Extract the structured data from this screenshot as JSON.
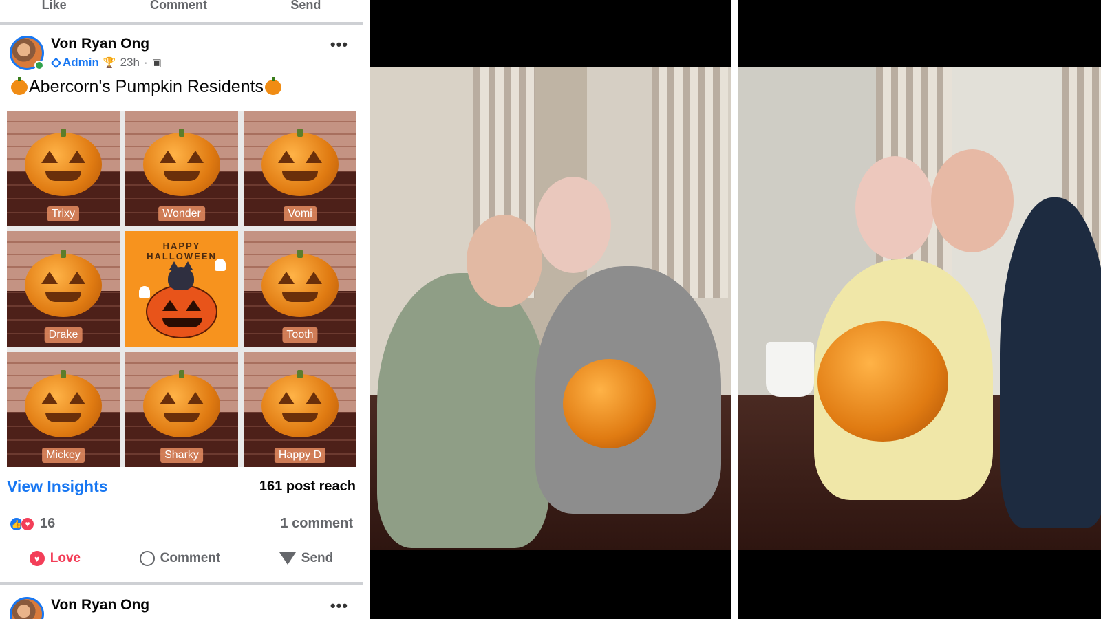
{
  "top_actions": [
    "Like",
    "Comment",
    "Send"
  ],
  "post": {
    "author": "Von Ryan Ong",
    "role": "Admin",
    "time": "23h",
    "more": "•••",
    "caption": "Abercorn's Pumpkin Residents",
    "pumpkins": [
      {
        "name": "Trixy"
      },
      {
        "name": "Wonder"
      },
      {
        "name": "Vomi"
      },
      {
        "name": "Drake"
      },
      {
        "name": "HALLOWEEN_CARD"
      },
      {
        "name": "Tooth"
      },
      {
        "name": "Mickey"
      },
      {
        "name": "Sharky"
      },
      {
        "name": "Happy D"
      }
    ],
    "card_line1": "HAPPY",
    "card_line2": "HALLOWEEN",
    "insights_label": "View Insights",
    "reach": "161 post reach",
    "reaction_count": "16",
    "comment_count": "1 comment",
    "actions": {
      "love": "Love",
      "comment": "Comment",
      "send": "Send"
    }
  },
  "next_post": {
    "author": "Von Ryan Ong"
  },
  "colors": {
    "brand": "#1877f2",
    "love": "#f33e58",
    "online": "#31a24c"
  }
}
